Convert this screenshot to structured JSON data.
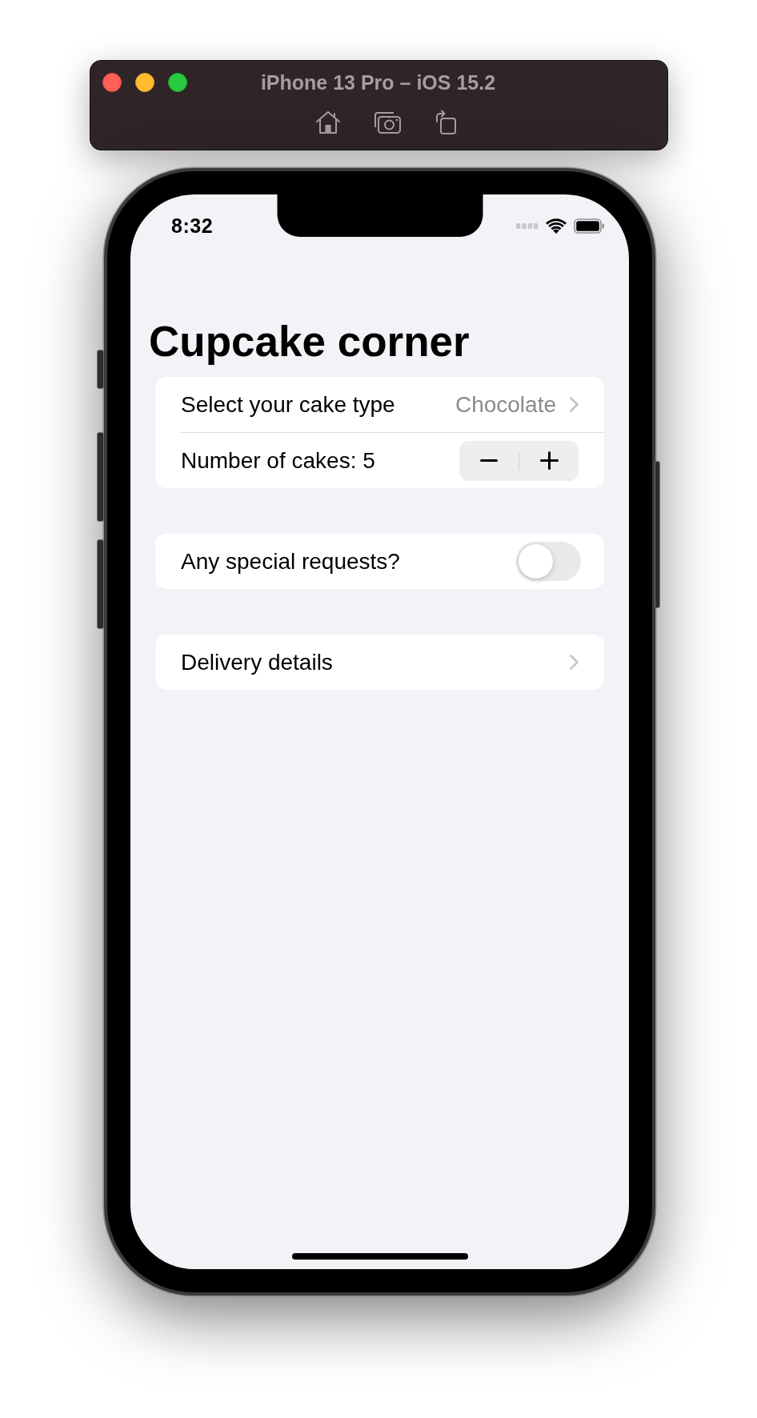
{
  "simulator": {
    "title": "iPhone 13 Pro – iOS 15.2"
  },
  "status_bar": {
    "time": "8:32"
  },
  "navigation": {
    "title": "Cupcake corner"
  },
  "sections": [
    {
      "rows": [
        {
          "kind": "picker",
          "label": "Select your cake type",
          "value": "Chocolate"
        },
        {
          "kind": "stepper",
          "label": "Number of cakes: 5"
        }
      ]
    },
    {
      "rows": [
        {
          "kind": "toggle",
          "label": "Any special requests?",
          "on": false
        }
      ]
    },
    {
      "rows": [
        {
          "kind": "link",
          "label": "Delivery details"
        }
      ]
    }
  ]
}
